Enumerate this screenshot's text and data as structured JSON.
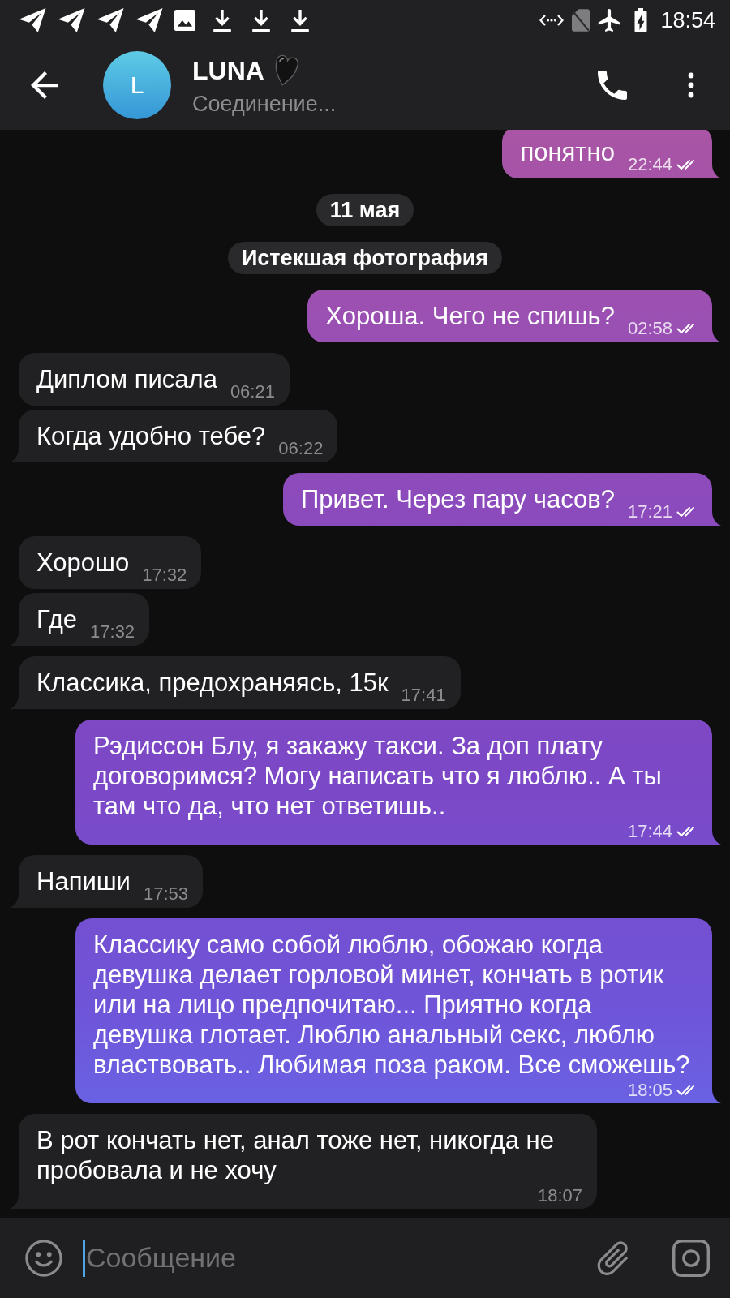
{
  "status_bar": {
    "time": "18:54"
  },
  "header": {
    "avatar_letter": "L",
    "name": "LUNA",
    "status": "Соединение..."
  },
  "messages": [
    {
      "kind": "outgoing",
      "text": "понятно",
      "time": "22:44",
      "read": true,
      "tail": true
    },
    {
      "kind": "date",
      "text": "11 мая"
    },
    {
      "kind": "service",
      "text": "Истекшая фотография"
    },
    {
      "kind": "outgoing",
      "text": "Хороша. Чего не спишь?",
      "time": "02:58",
      "read": true,
      "tail": true
    },
    {
      "kind": "incoming",
      "text": "Диплом писала",
      "time": "06:21",
      "tail": false
    },
    {
      "kind": "incoming",
      "text": "Когда удобно тебе?",
      "time": "06:22",
      "tail": true
    },
    {
      "kind": "outgoing",
      "text": "Привет. Через пару часов?",
      "time": "17:21",
      "read": true,
      "tail": true
    },
    {
      "kind": "incoming",
      "text": "Хорошо",
      "time": "17:32",
      "tail": false
    },
    {
      "kind": "incoming",
      "text": "Где",
      "time": "17:32",
      "tail": true
    },
    {
      "kind": "incoming",
      "text": "Классика, предохраняясь, 15к",
      "time": "17:41",
      "tail": true
    },
    {
      "kind": "outgoing",
      "text": "Рэдиссон Блу, я закажу такси. За доп плату договоримся? Могу написать что я люблю.. А ты там что да, что нет ответишь..",
      "time": "17:44",
      "read": true,
      "tail": true
    },
    {
      "kind": "incoming",
      "text": "Напиши",
      "time": "17:53",
      "tail": true
    },
    {
      "kind": "outgoing",
      "text": "Классику само собой люблю, обожаю когда девушка делает горловой минет, кончать в ротик или на лицо предпочитаю... Приятно когда девушка глотает. Люблю анальный секс, люблю властвовать.. Любимая поза раком. Все сможешь?",
      "time": "18:05",
      "read": true,
      "tail": true
    },
    {
      "kind": "incoming",
      "text": "В рот кончать нет, анал тоже нет, никогда не пробовала и не хочу",
      "time": "18:07",
      "tail": true
    }
  ],
  "composer": {
    "placeholder": "Сообщение"
  }
}
